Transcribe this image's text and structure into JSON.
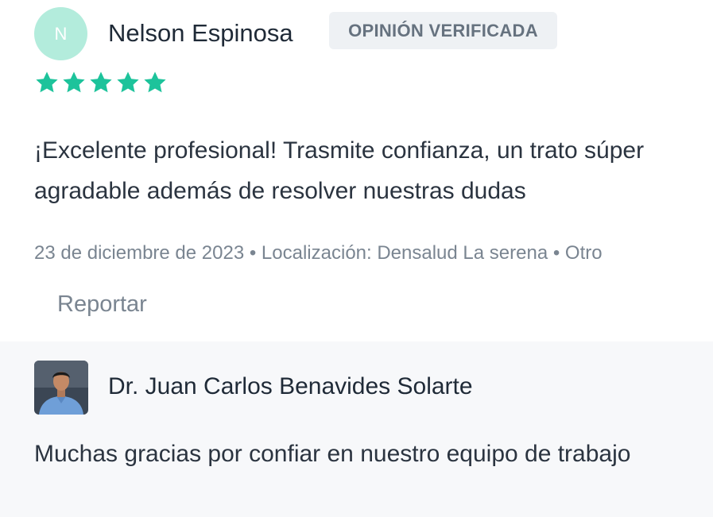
{
  "review": {
    "avatar_initial": "N",
    "reviewer_name": "Nelson Espinosa",
    "badge": "OPINIÓN VERIFICADA",
    "rating": 5,
    "rating_max": 5,
    "text": "¡Excelente profesional! Trasmite confianza, un trato súper agradable además de resolver nuestras dudas",
    "meta": "23 de diciembre de 2023 • Localización: Densalud La serena • Otro",
    "report_label": "Reportar"
  },
  "reply": {
    "doctor_name": "Dr. Juan Carlos Benavides Solarte",
    "text": "Muchas gracias por confiar en nuestro equipo de trabajo"
  },
  "colors": {
    "star": "#1dc39b",
    "avatar_bg": "#b3ecdc",
    "badge_bg": "#eef1f4",
    "reply_bg": "#f7f8fa"
  },
  "icons": {
    "star": "star-icon"
  }
}
